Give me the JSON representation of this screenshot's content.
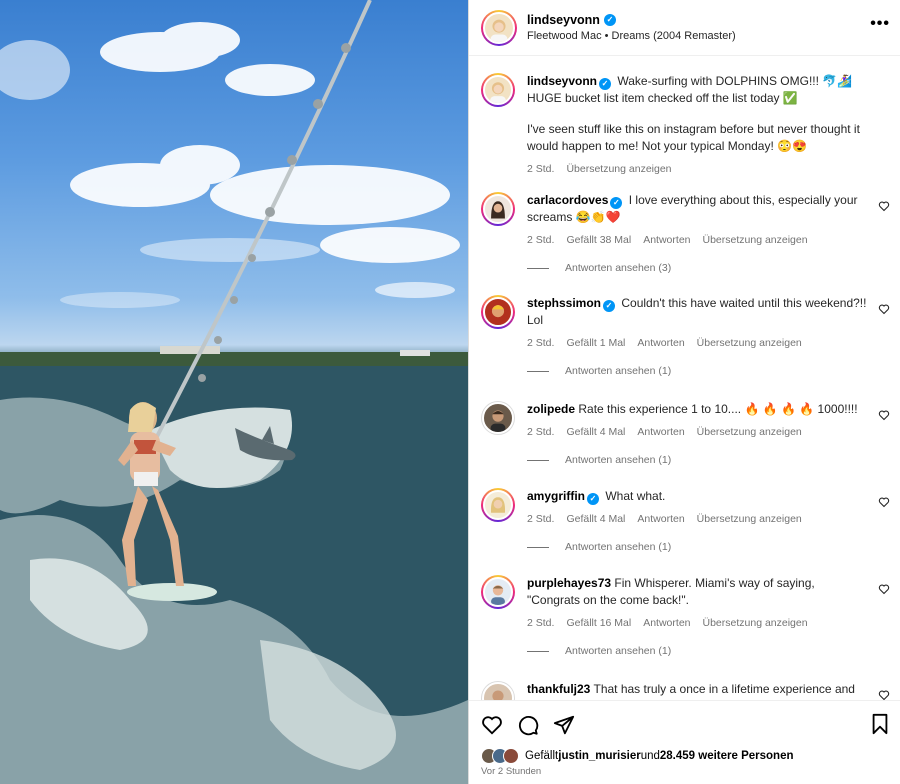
{
  "header": {
    "username": "lindseyvonn",
    "song": "Fleetwood Mac • Dreams (2004 Remaster)",
    "more_label": "•••"
  },
  "caption": {
    "username": "lindseyvonn",
    "text": "Wake-surfing with DOLPHINS OMG!!! 🐬🏄‍♀️ HUGE bucket list item checked off the list today ✅",
    "text2": "I've seen stuff like this on instagram before but never thought it would happen to me! Not your typical Monday! 😳😍",
    "time": "2 Std.",
    "translate": "Übersetzung anzeigen"
  },
  "comments": [
    {
      "username": "carlacordoves",
      "text": "I love everything about this, especially your screams 😂👏❤️",
      "time": "2 Std.",
      "likes": "Gefällt 38 Mal",
      "reply": "Antworten",
      "translate": "Übersetzung anzeigen",
      "replies": "Antworten ansehen (3)"
    },
    {
      "username": "stephssimon",
      "text": "Couldn't this have waited until this weekend?!! Lol",
      "time": "2 Std.",
      "likes": "Gefällt 1 Mal",
      "reply": "Antworten",
      "translate": "Übersetzung anzeigen",
      "replies": "Antworten ansehen (1)"
    },
    {
      "username": "zolipede",
      "text": "Rate this experience 1 to 10.... 🔥 🔥 🔥 🔥 1000!!!!",
      "time": "2 Std.",
      "likes": "Gefällt 4 Mal",
      "reply": "Antworten",
      "translate": "Übersetzung anzeigen",
      "replies": "Antworten ansehen (1)"
    },
    {
      "username": "amygriffin",
      "text": "What what.",
      "time": "2 Std.",
      "likes": "Gefällt 4 Mal",
      "reply": "Antworten",
      "translate": "Übersetzung anzeigen",
      "replies": "Antworten ansehen (1)"
    },
    {
      "username": "purplehayes73",
      "text": "Fin Whisperer. Miami's way of saying, \"Congrats on the come back!\".",
      "time": "2 Std.",
      "likes": "Gefällt 16 Mal",
      "reply": "Antworten",
      "translate": "Übersetzung anzeigen",
      "replies": "Antworten ansehen (1)"
    },
    {
      "username": "thankfulj23",
      "text": "That has truly a once in a lifetime experience and"
    }
  ],
  "likes": {
    "prefix": "Gefällt ",
    "user": "justin_murisier",
    "middle": " und ",
    "count": "28.459 weitere Personen",
    "time": "Vor 2 Stunden"
  },
  "colors": {
    "verified": "#0095f6",
    "meta_text": "#737373",
    "border": "#dbdbdb"
  },
  "icons": [
    "heart-icon",
    "comment-icon",
    "share-icon",
    "bookmark-icon",
    "more-icon",
    "verified-icon"
  ]
}
